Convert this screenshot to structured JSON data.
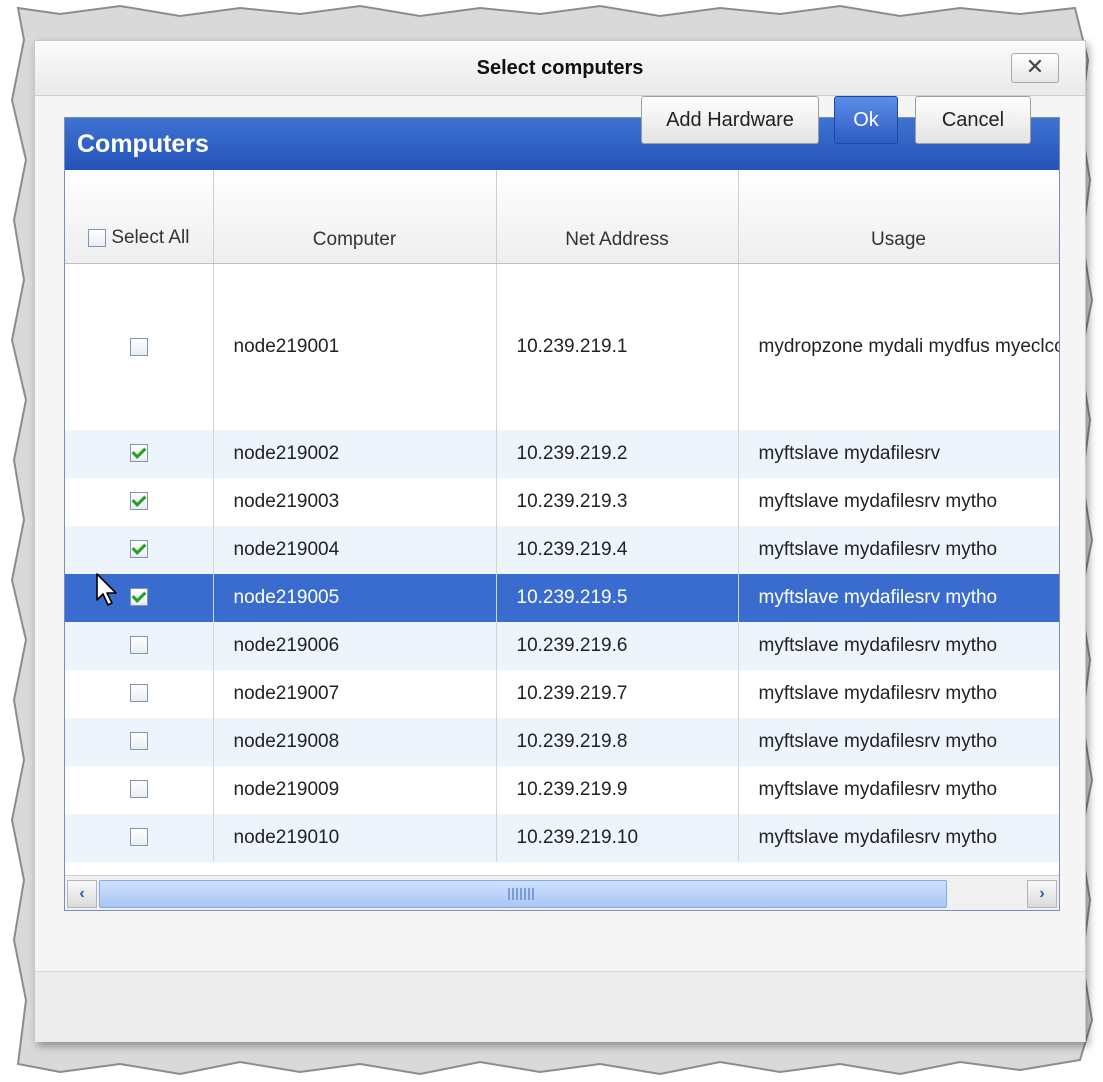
{
  "dialog": {
    "title": "Select computers",
    "close_glyph": "✕"
  },
  "panel": {
    "title": "Computers"
  },
  "columns": {
    "select_all": "Select All",
    "computer": "Computer",
    "net_address": "Net Address",
    "usage": "Usage"
  },
  "rows": [
    {
      "checked": false,
      "computer": "node219001",
      "address": "10.239.219.1",
      "usage": "mydropzone mydali mydfus myeclccserver myesp myeclagent myftslave mysa mydafilesrv mythor myeclscheduler"
    },
    {
      "checked": true,
      "computer": "node219002",
      "address": "10.239.219.2",
      "usage": "myftslave mydafilesrv"
    },
    {
      "checked": true,
      "computer": "node219003",
      "address": "10.239.219.3",
      "usage": "myftslave mydafilesrv mytho"
    },
    {
      "checked": true,
      "computer": "node219004",
      "address": "10.239.219.4",
      "usage": "myftslave mydafilesrv mytho"
    },
    {
      "checked": true,
      "computer": "node219005",
      "address": "10.239.219.5",
      "usage": "myftslave mydafilesrv mytho"
    },
    {
      "checked": false,
      "computer": "node219006",
      "address": "10.239.219.6",
      "usage": "myftslave mydafilesrv mytho"
    },
    {
      "checked": false,
      "computer": "node219007",
      "address": "10.239.219.7",
      "usage": "myftslave mydafilesrv mytho"
    },
    {
      "checked": false,
      "computer": "node219008",
      "address": "10.239.219.8",
      "usage": "myftslave mydafilesrv mytho"
    },
    {
      "checked": false,
      "computer": "node219009",
      "address": "10.239.219.9",
      "usage": "myftslave mydafilesrv mytho"
    },
    {
      "checked": false,
      "computer": "node219010",
      "address": "10.239.219.10",
      "usage": "myftslave mydafilesrv mytho"
    }
  ],
  "scrollbar": {
    "left_glyph": "‹",
    "right_glyph": "›"
  },
  "footer": {
    "add_hardware": "Add Hardware",
    "ok": "Ok",
    "cancel": "Cancel"
  },
  "colors": {
    "header_blue": "#2c5ec4",
    "selected_row": "#3a6ccf",
    "alt_row": "#eef4fc",
    "check_green": "#23a023"
  }
}
